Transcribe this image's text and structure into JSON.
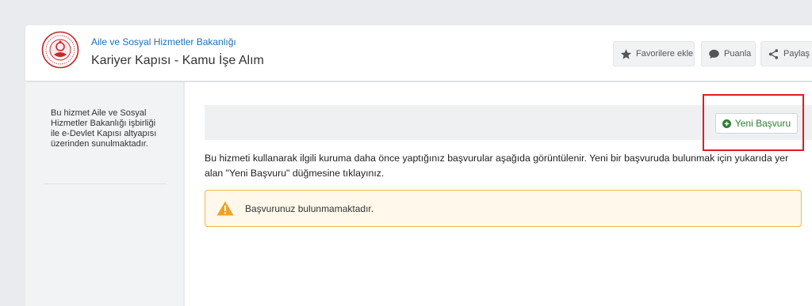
{
  "header": {
    "ministry": "Aile ve Sosyal Hizmetler Bakanlığı",
    "title": "Kariyer Kapısı - Kamu İşe Alım",
    "buttons": {
      "favorite": "Favorilere ekle",
      "rate": "Puanla",
      "share": "Paylaş"
    }
  },
  "sidebar": {
    "text": "Bu hizmet Aile ve Sosyal Hizmetler Bakanlığı işbirliği ile e-Devlet Kapısı altyapısı üzerinden sunulmaktadır."
  },
  "main": {
    "new_application_label": "Yeni Başvuru",
    "description": "Bu hizmeti kullanarak ilgili kuruma daha önce yaptığınız başvurular aşağıda görüntülenir. Yeni bir başvuruda bulunmak için yukarıda yer alan \"Yeni Başvuru\" düğmesine tıklayınız.",
    "alert_text": "Başvurunuz bulunmamaktadır."
  },
  "colors": {
    "ministry_blue": "#1d6fb8",
    "success_green": "#2e7d32",
    "highlight_red": "#e01b24",
    "warning_orange": "#f1a226"
  }
}
